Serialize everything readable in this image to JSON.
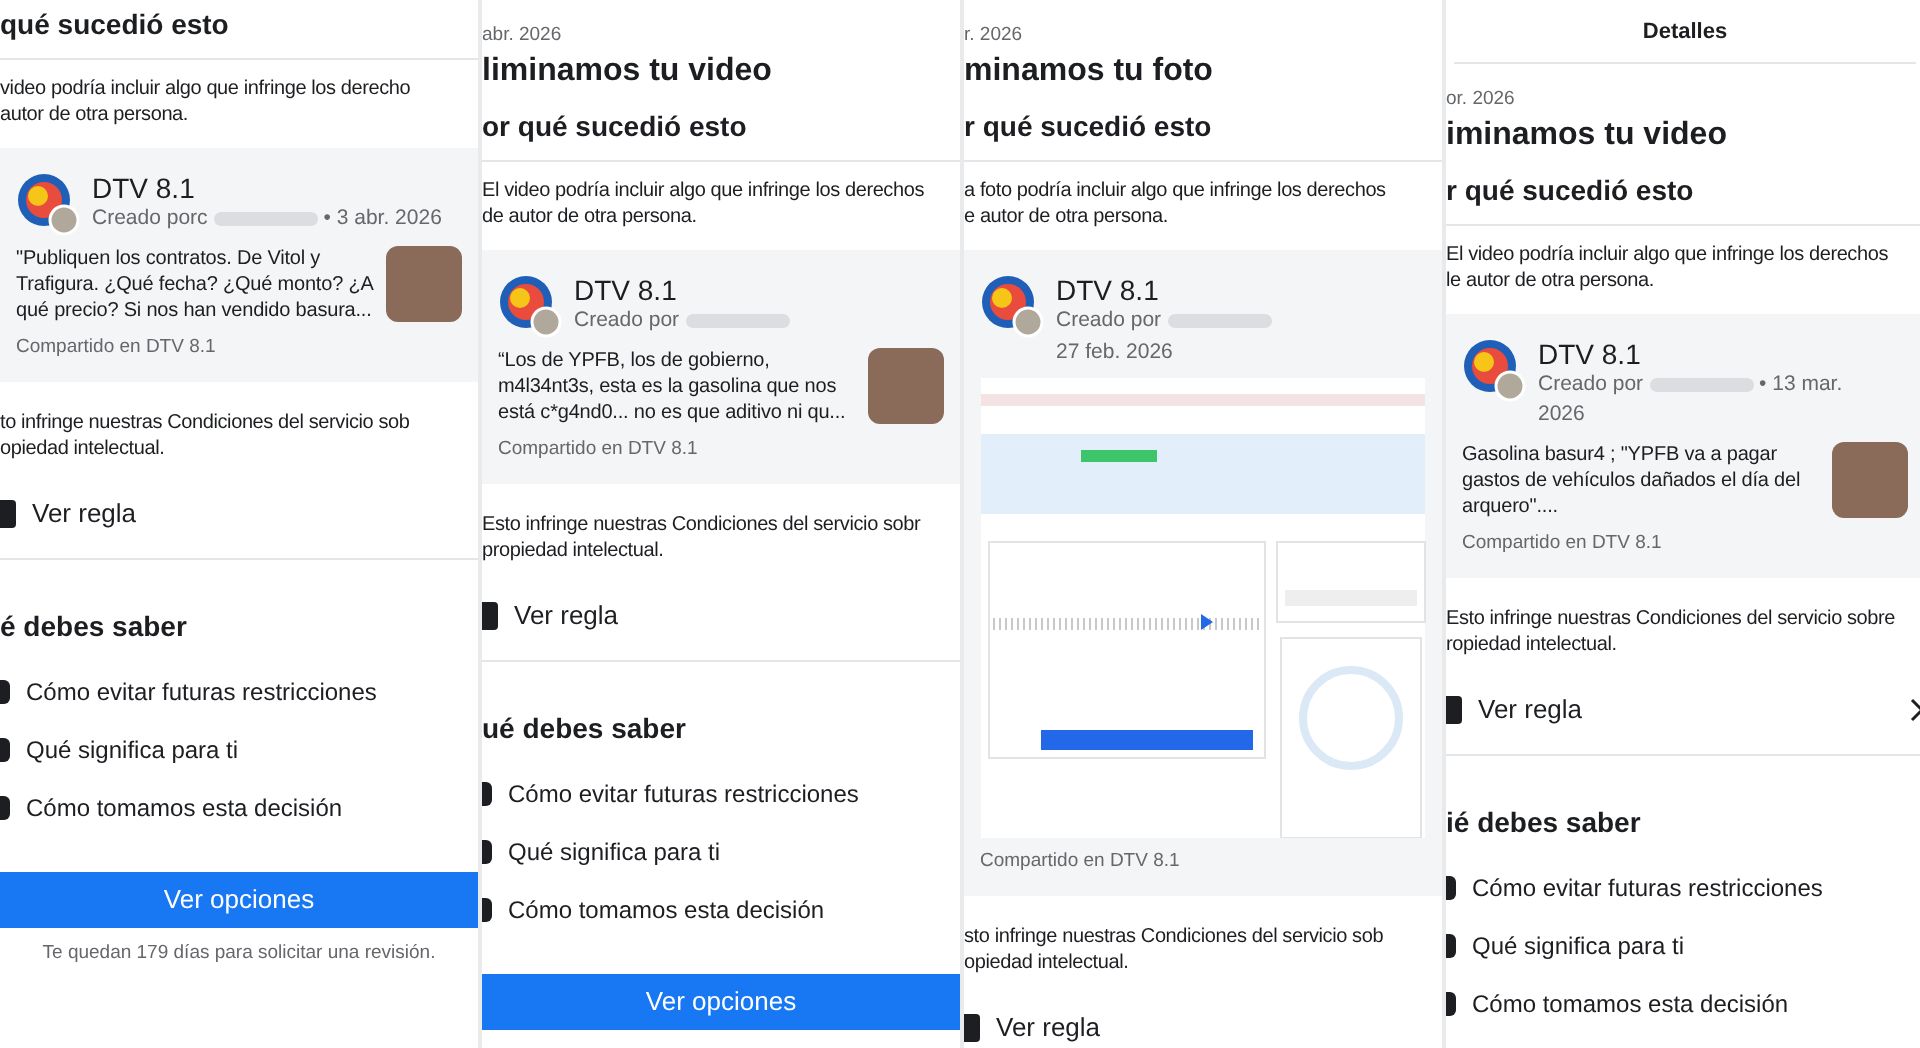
{
  "panels": [
    {
      "section_heading": "qué sucedió esto",
      "reason": [
        "video podría incluir algo que infringe los derecho",
        "autor de otra persona."
      ],
      "post": {
        "name": "DTV 8.1",
        "meta_prefix": "Creado porc",
        "meta_suffix": "• 3 abr. 2026",
        "body": [
          "\"Publiquen los contratos. De Vitol y",
          "Trafigura. ¿Qué fecha? ¿Qué monto? ¿A",
          "qué precio? Si nos han vendido basura..."
        ],
        "shared": "Compartido en DTV 8.1",
        "thumbnail": true
      },
      "terms": [
        "to infringe nuestras Condiciones del servicio sob",
        "opiedad intelectual."
      ],
      "rule_link": "Ver regla",
      "know_heading": "é debes saber",
      "know_items": [
        "Cómo evitar futuras restricciones",
        "Qué significa para ti",
        "Cómo tomamos esta decisión"
      ],
      "button": "Ver opciones",
      "footer": "Te quedan 179 días para solicitar una revisión."
    },
    {
      "date": "abr. 2026",
      "title": "liminamos tu video",
      "section_heading": "or qué sucedió esto",
      "reason": [
        "El video podría incluir algo que infringe los derechos",
        "de autor de otra persona."
      ],
      "post": {
        "name": "DTV 8.1",
        "meta_prefix": "Creado por",
        "body": [
          "“Los de YPFB, los de gobierno,",
          "m4l34nt3s, esta es la gasolina que nos",
          "está c*g4nd0... no es que aditivo ni qu..."
        ],
        "shared": "Compartido en DTV 8.1",
        "thumbnail": true
      },
      "terms": [
        "Esto infringe nuestras Condiciones del servicio sobr",
        "propiedad intelectual."
      ],
      "rule_link": "Ver regla",
      "know_heading": "ué debes saber",
      "know_items": [
        "Cómo evitar futuras restricciones",
        "Qué significa para ti",
        "Cómo tomamos esta decisión"
      ],
      "button": "Ver opciones"
    },
    {
      "date": "r. 2026",
      "title": "minamos tu foto",
      "section_heading": "r qué sucedió esto",
      "reason": [
        "a foto podría incluir algo que infringe los derechos",
        "e autor de otra persona."
      ],
      "post": {
        "name": "DTV 8.1",
        "meta_prefix": "Creado por",
        "meta_line2": "27 feb. 2026",
        "shared": "Compartido en DTV 8.1",
        "screenshot": true
      },
      "terms": [
        "sto infringe nuestras Condiciones del servicio sob",
        "opiedad intelectual."
      ],
      "rule_link": "Ver regla"
    },
    {
      "header": "Detalles",
      "date": "or. 2026",
      "title": "iminamos tu video",
      "section_heading": "r qué sucedió esto",
      "reason": [
        "El video podría incluir algo que infringe los derechos",
        "le autor de otra persona."
      ],
      "post": {
        "name": "DTV 8.1",
        "meta_prefix": "Creado por",
        "meta_suffix": "• 13 mar.",
        "meta_line2": "2026",
        "body": [
          "Gasolina basur4 ; \"YPFB va a pagar",
          "gastos de vehículos dañados el día del",
          "arquero\"...."
        ],
        "shared": "Compartido en DTV 8.1",
        "thumbnail": true
      },
      "terms": [
        "Esto infringe nuestras Condiciones del servicio sobre",
        "ropiedad intelectual."
      ],
      "rule_link": "Ver regla",
      "know_heading": "ié debes saber",
      "know_items": [
        "Cómo evitar futuras restricciones",
        "Qué significa para ti",
        "Cómo tomamos esta decisión"
      ]
    }
  ]
}
